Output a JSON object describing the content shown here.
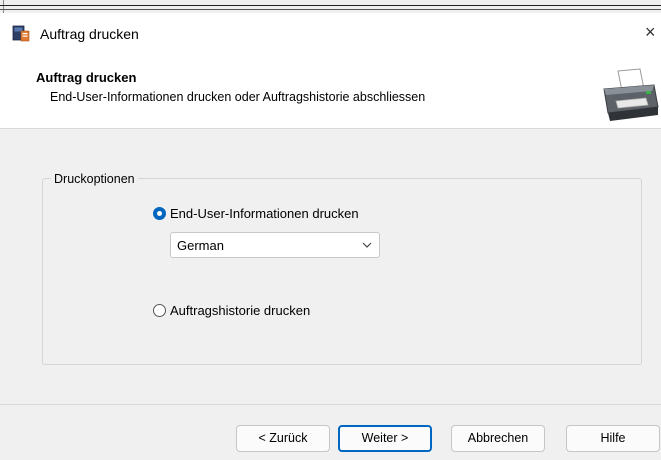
{
  "window": {
    "title": "Auftrag drucken",
    "close_glyph": "×",
    "app_icon": "app-icon",
    "close_icon": "close-icon"
  },
  "header": {
    "title": "Auftrag drucken",
    "subtitle": "End-User-Informationen drucken oder Auftragshistorie abschliessen",
    "image": "printer-icon"
  },
  "group": {
    "label": "Druckoptionen",
    "options": [
      {
        "label": "End-User-Informationen drucken",
        "selected": true
      },
      {
        "label": "Auftragshistorie drucken",
        "selected": false
      }
    ],
    "language_select": {
      "value": "German",
      "icon": "chevron-down-icon"
    }
  },
  "footer": {
    "back_label": "< Zurück",
    "next_label": "Weiter >",
    "cancel_label": "Abbrechen",
    "help_label": "Hilfe"
  },
  "colors": {
    "accent": "#0067c0",
    "panel": "#f0f0f0",
    "border": "#d5d5d5"
  }
}
